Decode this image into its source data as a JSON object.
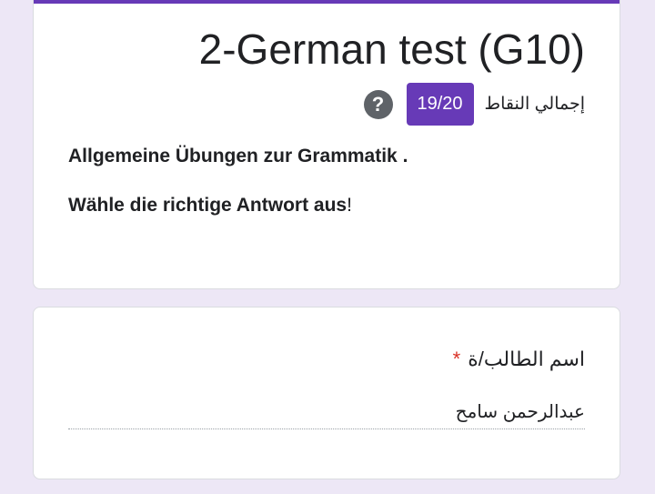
{
  "form": {
    "title": "2-German test (G10)",
    "score_label": "إجمالي النقاط",
    "score_value": "19/20",
    "help_icon_glyph": "?",
    "description_line1": "Allgemeine Übungen zur Grammatik .",
    "description_line2": "Wähle die richtige Antwort aus",
    "description_line2_punct": "!"
  },
  "question": {
    "title": "اسم الطالب/ة",
    "required_marker": "*",
    "answer": "عبدالرحمن سامح"
  },
  "colors": {
    "accent": "#673ab7",
    "background": "#ede7f6",
    "required": "#d93025"
  }
}
